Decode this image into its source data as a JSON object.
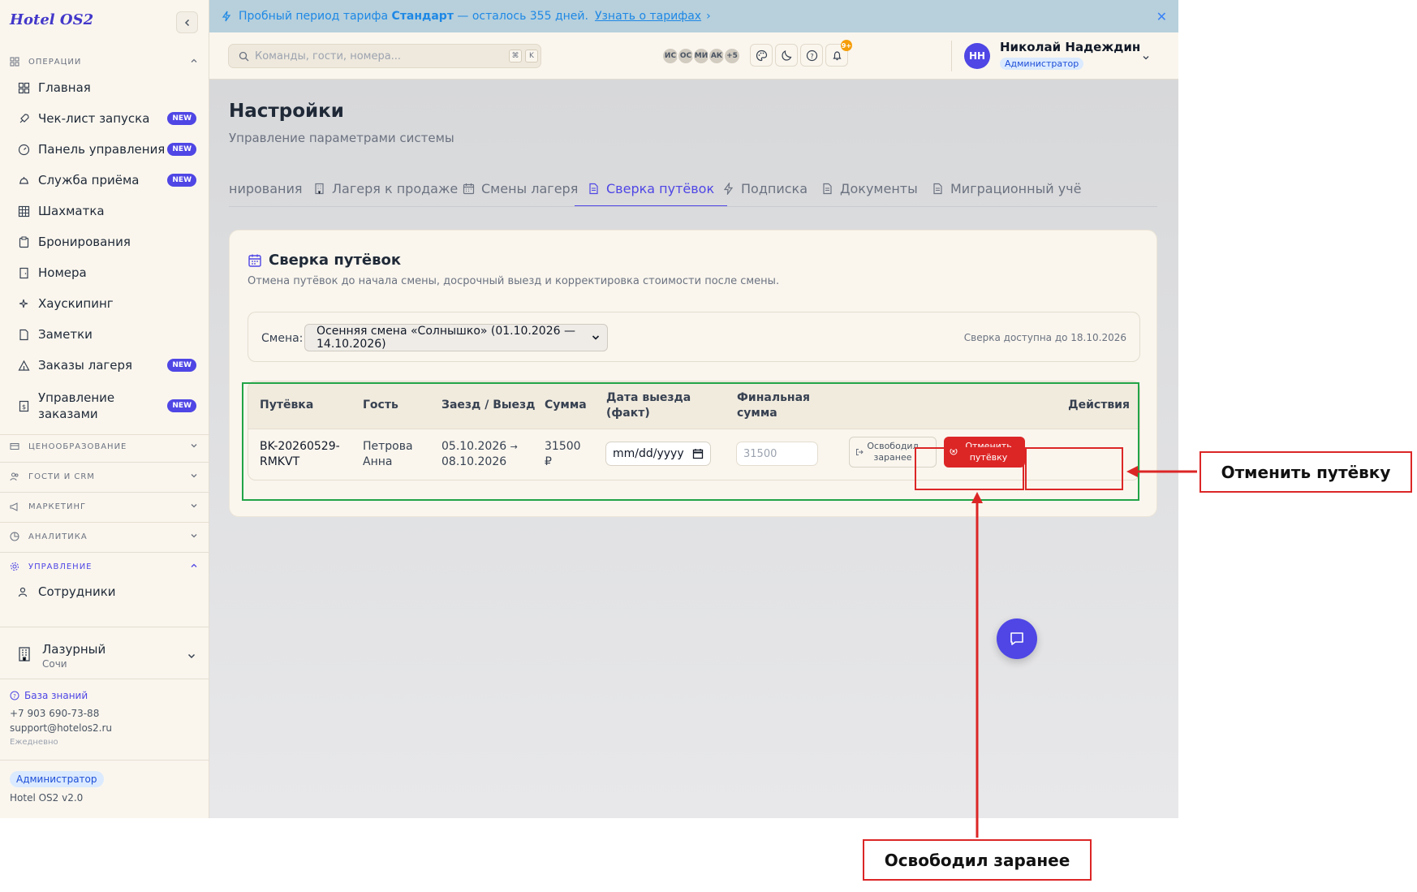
{
  "brand": "Hotel OS2",
  "sidebar": {
    "sections": {
      "operations": "ОПЕРАЦИИ",
      "pricing": "ЦЕНООБРАЗОВАНИЕ",
      "guests": "ГОСТИ И CRM",
      "marketing": "МАРКЕТИНГ",
      "analytics": "АНАЛИТИКА",
      "management": "УПРАВЛЕНИЕ"
    },
    "items": [
      {
        "label": "Главная",
        "badge": ""
      },
      {
        "label": "Чек-лист запуска",
        "badge": "NEW"
      },
      {
        "label": "Панель управления",
        "badge": "NEW"
      },
      {
        "label": "Служба приёма",
        "badge": "NEW"
      },
      {
        "label": "Шахматка",
        "badge": ""
      },
      {
        "label": "Бронирования",
        "badge": ""
      },
      {
        "label": "Номера",
        "badge": ""
      },
      {
        "label": "Хаускипинг",
        "badge": ""
      },
      {
        "label": "Заметки",
        "badge": ""
      },
      {
        "label": "Заказы лагеря",
        "badge": "NEW"
      },
      {
        "label": "Управление заказами",
        "badge": "NEW"
      }
    ],
    "staff_label": "Сотрудники",
    "hotel": {
      "name": "Лазурный",
      "city": "Сочи"
    },
    "support": {
      "kb": "База знаний",
      "phone": "+7 903 690-73-88",
      "email": "support@hotelos2.ru",
      "hours": "Ежедневно"
    },
    "role": "Администратор",
    "version": "Hotel OS2 v2.0"
  },
  "banner": {
    "text_prefix": "Пробный период тарифа",
    "plan": "Стандарт",
    "text_suffix": "— осталось 355 дней.",
    "link": "Узнать о тарифах",
    "link_arrow": "›",
    "close": "✕"
  },
  "header": {
    "search_placeholder": "Команды, гости, номера...",
    "kbd_mod": "⌘",
    "kbd_key": "K",
    "avatars": [
      "ИС",
      "ОС",
      "МИ",
      "АК"
    ],
    "avatars_more": "+5",
    "notif_count": "9+",
    "user": {
      "initials": "НН",
      "name": "Николай Надеждин",
      "role": "Администратор"
    }
  },
  "page": {
    "title": "Настройки",
    "subtitle": "Управление параметрами системы",
    "tabs": [
      {
        "label": "нирования",
        "icon": "none"
      },
      {
        "label": "Лагеря к продаже",
        "icon": "building-icon"
      },
      {
        "label": "Смены лагеря",
        "icon": "calendar-icon"
      },
      {
        "label": "Сверка путёвок",
        "icon": "document-icon"
      },
      {
        "label": "Подписка",
        "icon": "lightning-icon"
      },
      {
        "label": "Документы",
        "icon": "document-icon"
      },
      {
        "label": "Миграционный учё",
        "icon": "document-icon"
      }
    ],
    "active_tab": 3
  },
  "card": {
    "title": "Сверка путёвок",
    "description": "Отмена путёвок до начала смены, досрочный выезд и корректировка стоимости после смены.",
    "shift_label": "Смена:",
    "shift_value": "Осенняя смена «Солнышко» (01.10.2026 — 14.10.2026)",
    "note": "Сверка доступна до 18.10.2026"
  },
  "table": {
    "headers": {
      "voucher": "Путёвка",
      "guest": "Гость",
      "dates": "Заезд / Выезд",
      "sum": "Сумма",
      "checkout_line1": "Дата выезда",
      "checkout_line2": "(факт)",
      "final_line1": "Финальная",
      "final_line2": "сумма",
      "actions": "Действия"
    },
    "row": {
      "voucher_line1": "BK-20260529-",
      "voucher_line2": "RMKVT",
      "guest_line1": "Петрова",
      "guest_line2": "Анна",
      "checkin": "05.10.2026",
      "arrow": "→",
      "checkout": "08.10.2026",
      "sum_line1": "31500",
      "sum_line2": "₽",
      "date_placeholder": "mm/dd/yyyy",
      "final_placeholder": "31500",
      "release_line1": "Освободил",
      "release_line2": "заранее",
      "cancel_line1": "Отменить",
      "cancel_line2": "путёвку"
    }
  },
  "annotations": {
    "cancel": "Отменить путёвку",
    "release": "Освободил заранее"
  },
  "colors": {
    "accent": "#4f46e5",
    "danger": "#dc2626",
    "highlight_green": "#22a447",
    "sidebar_bg": "#faf6ee"
  }
}
